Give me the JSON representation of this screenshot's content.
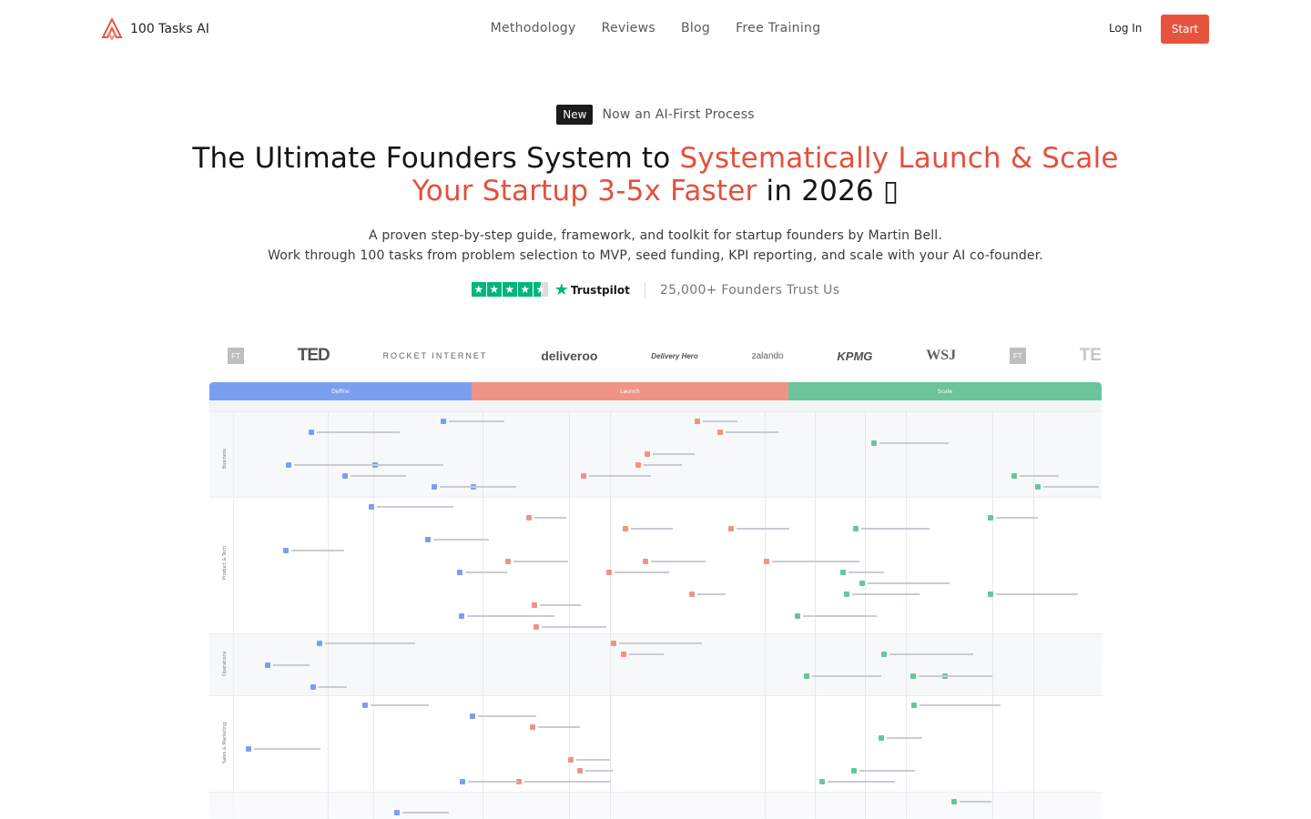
{
  "brand": {
    "name": "100 Tasks AI",
    "accent": "#e8533f",
    "icon": "logo-mark-icon"
  },
  "nav": {
    "items": [
      "Methodology",
      "Reviews",
      "Blog",
      "Free Training"
    ],
    "login_label": "Log In",
    "start_label": "Start"
  },
  "hero": {
    "badge_label": "New",
    "badge_text": "Now an AI-First Process",
    "headline_part1": "The Ultimate Founders System to ",
    "headline_highlight1": "Systematically Launch & Scale",
    "headline_highlight2": "Your Startup 3-5x Faster",
    "headline_part2": " in 2026 ",
    "headline_glyph": "▯",
    "sub_line1": "A proven step-by-step guide, framework, and toolkit for startup founders by Martin Bell.",
    "sub_line2": "Work through 100 tasks from problem selection to MVP, seed funding, KPI reporting, and scale with your AI co-founder.",
    "rating_stars": 4.5,
    "trustpilot_label": "Trustpilot",
    "trust_text": "25,000+ Founders Trust Us"
  },
  "press_logos": [
    "FT",
    "TED",
    "ROCKET INTERNET",
    "deliveroo",
    "Delivery Hero",
    "zalando",
    "KPMG",
    "WSJ",
    "FT",
    "TE"
  ],
  "board": {
    "phases": [
      {
        "label": "Define",
        "color": "#7b9ff0"
      },
      {
        "label": "Launch",
        "color": "#ef9485"
      },
      {
        "label": "Scale",
        "color": "#6cc49b"
      }
    ],
    "lanes": [
      "Business",
      "Product & Tech",
      "Operations",
      "Sales & Marketing"
    ]
  }
}
